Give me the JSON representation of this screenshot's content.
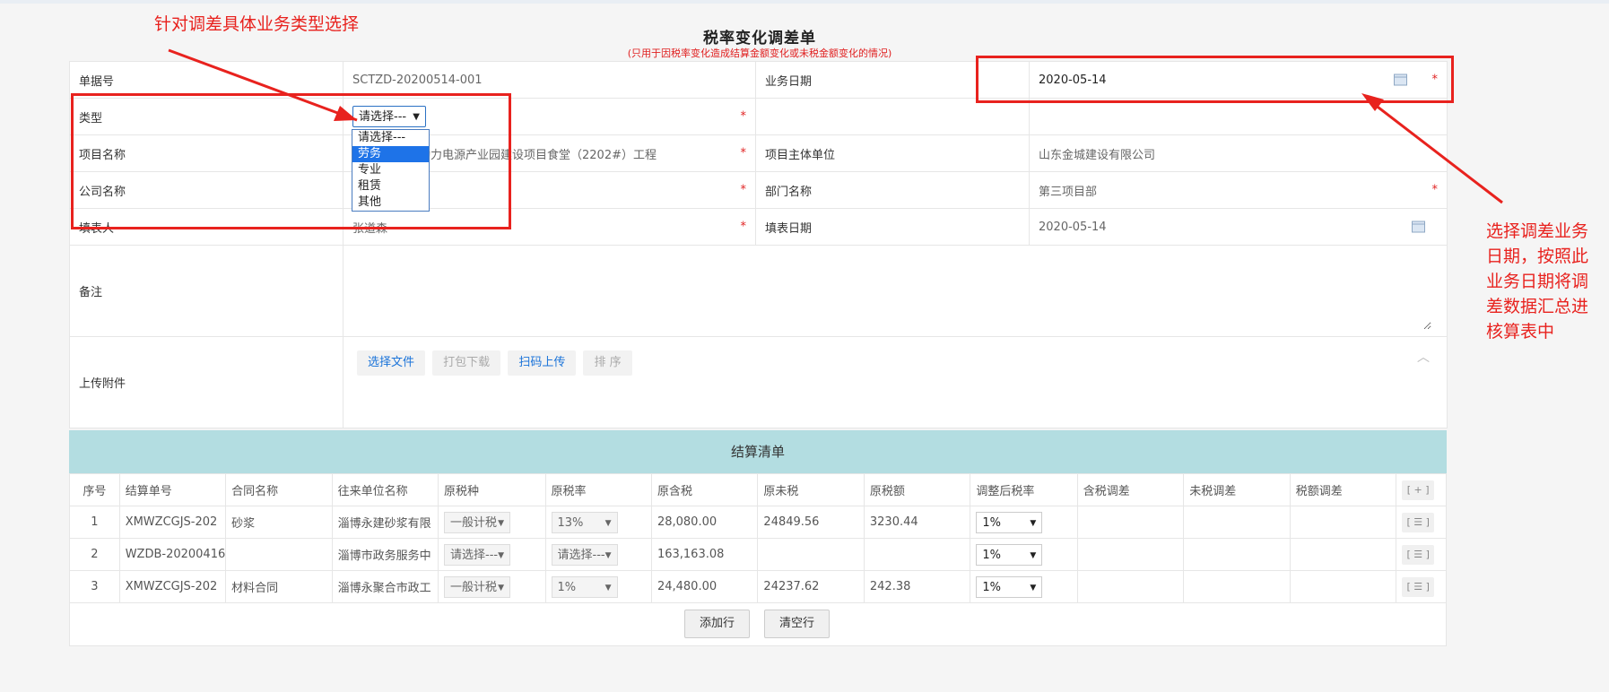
{
  "form": {
    "title": "税率变化调差单",
    "subtitle": "(只用于因税率变化造成结算金额变化或未税金额变化的情况)",
    "doc_no_label": "单据号",
    "doc_no": "SCTZD-20200514-001",
    "biz_date_label": "业务日期",
    "biz_date": "2020-05-14",
    "type_label": "类型",
    "type_value": "请选择---",
    "project_label": "项目名称",
    "project_value": "动力电源产业园建设项目食堂（2202#）工程",
    "project_entity_label": "项目主体单位",
    "project_entity_value": "山东金城建设有限公司",
    "company_label": "公司名称",
    "dept_label": "部门名称",
    "dept_value": "第三项目部",
    "filler_label": "填表人",
    "filler_value": "张道森",
    "fill_date_label": "填表日期",
    "fill_date": "2020-05-14",
    "remark_label": "备注",
    "attach_label": "上传附件",
    "required_mark": "*"
  },
  "type_options": [
    "请选择---",
    "劳务",
    "专业",
    "租赁",
    "其他"
  ],
  "type_selected_index": 1,
  "attach_buttons": {
    "choose": "选择文件",
    "pack": "打包下载",
    "scan": "扫码上传",
    "sort": "排 序"
  },
  "settlement": {
    "title": "结算清单",
    "columns": [
      "序号",
      "结算单号",
      "合同名称",
      "往来单位名称",
      "原税种",
      "原税率",
      "原含税",
      "原未税",
      "原税额",
      "调整后税率",
      "含税调差",
      "未税调差",
      "税额调差",
      "[ + ]"
    ],
    "rows": [
      {
        "no": "1",
        "settle_no": "XMWZCGJS-202",
        "contract": "砂浆",
        "unit": "淄博永建砂浆有限",
        "tax_type": "一般计税",
        "tax_rate": "13%",
        "incl": "28,080.00",
        "excl": "24849.56",
        "tax": "3230.44",
        "adj_rate": "1%",
        "btn": "[ ☰ ]"
      },
      {
        "no": "2",
        "settle_no": "WZDB-20200416",
        "contract": "",
        "unit": "淄博市政务服务中",
        "tax_type": "请选择---",
        "tax_rate": "请选择---",
        "incl": "163,163.08",
        "excl": "",
        "tax": "",
        "adj_rate": "1%",
        "btn": "[ ☰ ]"
      },
      {
        "no": "3",
        "settle_no": "XMWZCGJS-202",
        "contract": "材料合同",
        "unit": "淄博永聚合市政工",
        "tax_type": "一般计税",
        "tax_rate": "1%",
        "incl": "24,480.00",
        "excl": "24237.62",
        "tax": "242.38",
        "adj_rate": "1%",
        "btn": "[ ☰ ]"
      }
    ],
    "add_row": "添加行",
    "clear_row": "清空行"
  },
  "annotations": {
    "top": "针对调差具体业务类型选择",
    "right": "选择调差业务日期，按照此业务日期将调差数据汇总进核算表中"
  },
  "colors": {
    "accent": "#1e73e8",
    "annotation": "#e8221e",
    "settle_header": "#b3dde1"
  }
}
